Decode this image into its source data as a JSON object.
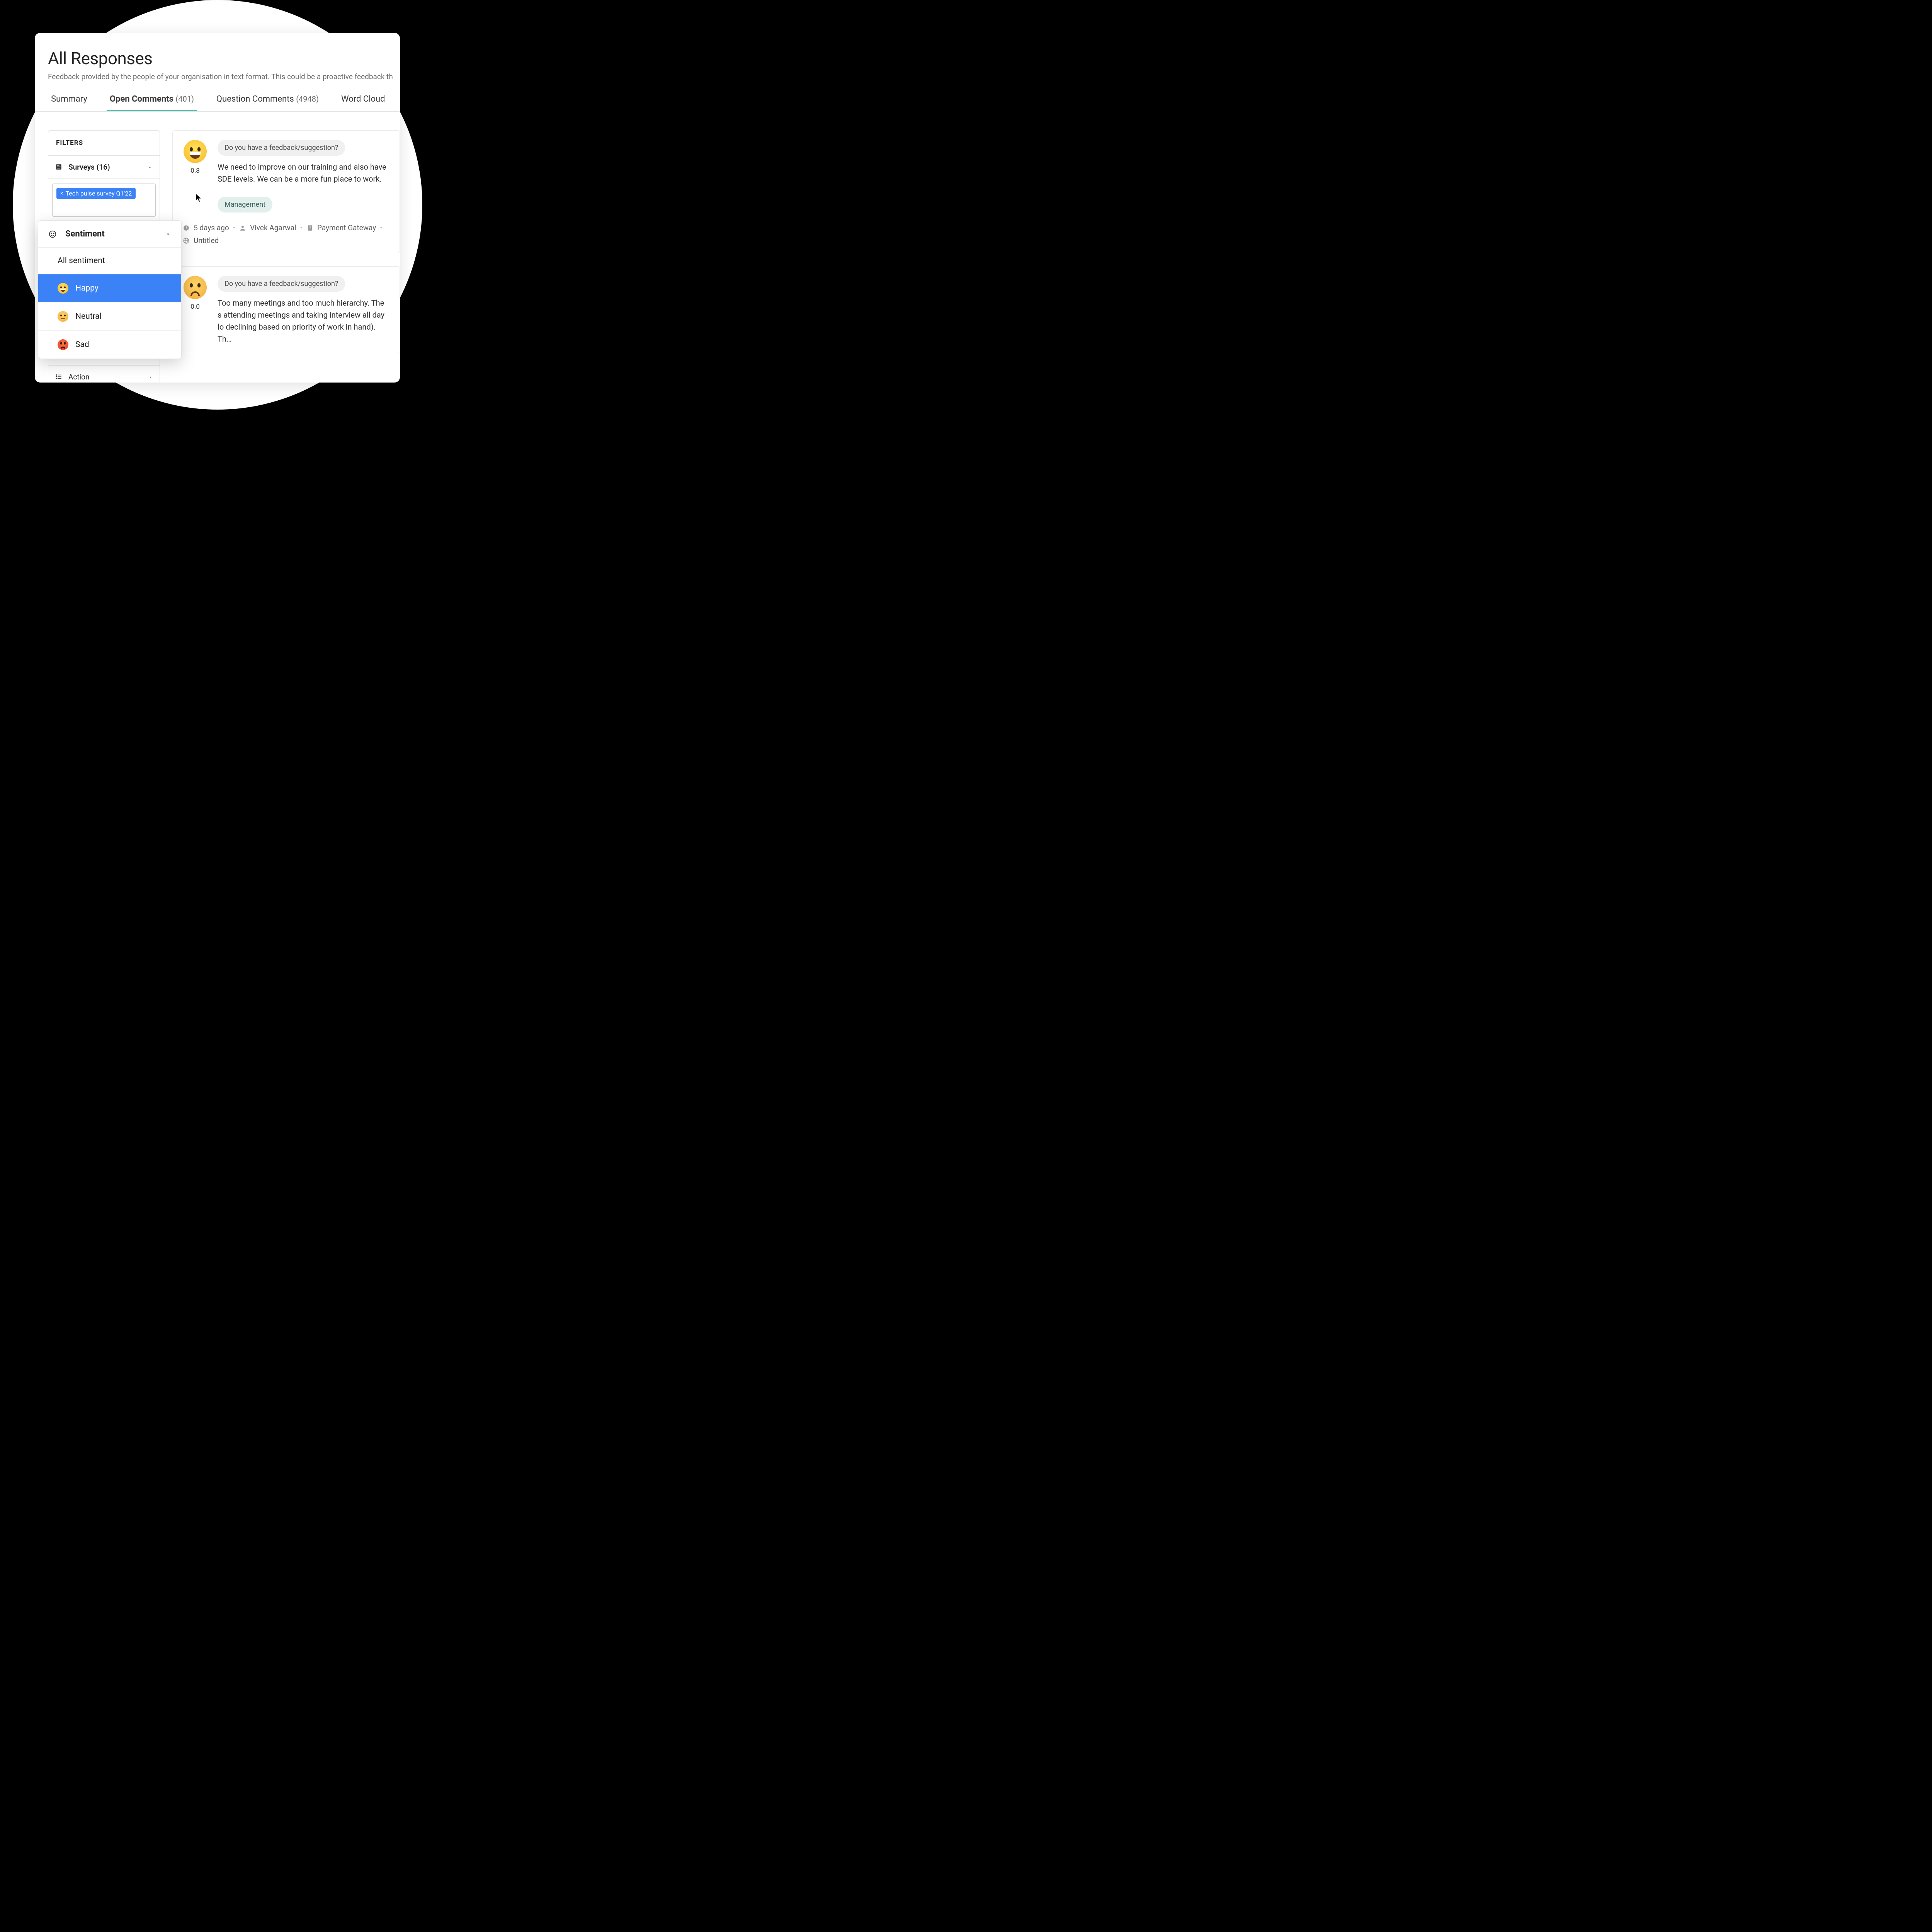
{
  "header": {
    "title": "All Responses",
    "subtitle": "Feedback provided by the people of your organisation in text format. This could be a proactive feedback th"
  },
  "tabs": [
    {
      "label": "Summary",
      "count": null,
      "active": false
    },
    {
      "label": "Open Comments",
      "count": "(401)",
      "active": true
    },
    {
      "label": "Question Comments",
      "count": "(4948)",
      "active": false
    },
    {
      "label": "Word Cloud",
      "count": null,
      "active": false
    }
  ],
  "filters": {
    "title": "FILTERS",
    "surveys": {
      "label": "Surveys (16)",
      "chip": "Tech pulse survey Q1'22"
    },
    "action": {
      "label": "Action"
    }
  },
  "sentiment_dropdown": {
    "title": "Sentiment",
    "items": [
      {
        "label": "All sentiment",
        "emoji": null,
        "highlight": false
      },
      {
        "label": "Happy",
        "emoji": "happy",
        "highlight": true
      },
      {
        "label": "Neutral",
        "emoji": "neutral",
        "highlight": false
      },
      {
        "label": "Sad",
        "emoji": "angry",
        "highlight": false
      }
    ]
  },
  "comments": [
    {
      "emoji": "happy",
      "score": "0.8",
      "question": "Do you have a feedback/suggestion?",
      "text": "We need to improve on our training and also have SDE levels. We can be a more fun place to work.",
      "tag": "Management",
      "meta": {
        "time": "5 days ago",
        "person": "Vivek Agarwal",
        "org": "Payment Gateway",
        "extra": "Untitled"
      }
    },
    {
      "emoji": "sad",
      "score": "0.0",
      "question": "Do you have a feedback/suggestion?",
      "text": "Too many meetings and too much hierarchy. The s attending meetings and taking interview all day lo declining based on priority of work in hand). Th…",
      "tag": null,
      "meta": null
    }
  ]
}
